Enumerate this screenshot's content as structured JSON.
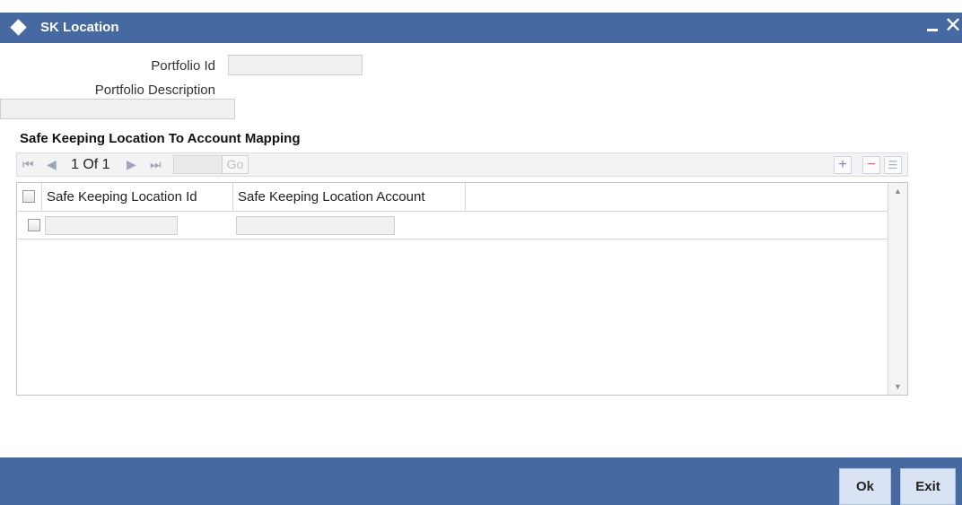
{
  "window": {
    "title": "SK Location",
    "minimize_icon": "minimize-icon",
    "close_icon": "close-icon",
    "close_glyph": "✕"
  },
  "form": {
    "portfolio_id_label": "Portfolio Id",
    "portfolio_id_value": "",
    "portfolio_description_label": "Portfolio Description",
    "portfolio_description_value": ""
  },
  "section": {
    "title": "Safe Keeping Location To Account Mapping"
  },
  "pager": {
    "first_icon": "first-page-icon",
    "prev_icon": "previous-page-icon",
    "next_icon": "next-page-icon",
    "last_icon": "last-page-icon",
    "text": "1 Of 1",
    "page_value": "",
    "go_label": "Go",
    "add_icon": "add-row-icon",
    "delete_icon": "delete-row-icon",
    "view_icon": "single-view-icon"
  },
  "grid": {
    "columns": [
      "Safe Keeping Location Id",
      "Safe Keeping Location Account"
    ],
    "rows": [
      {
        "location_id": "",
        "location_account": ""
      }
    ]
  },
  "footer": {
    "ok_label": "Ok",
    "exit_label": "Exit"
  },
  "colors": {
    "titlebar": "#4669a1",
    "button_bg": "#d9e3f3"
  }
}
